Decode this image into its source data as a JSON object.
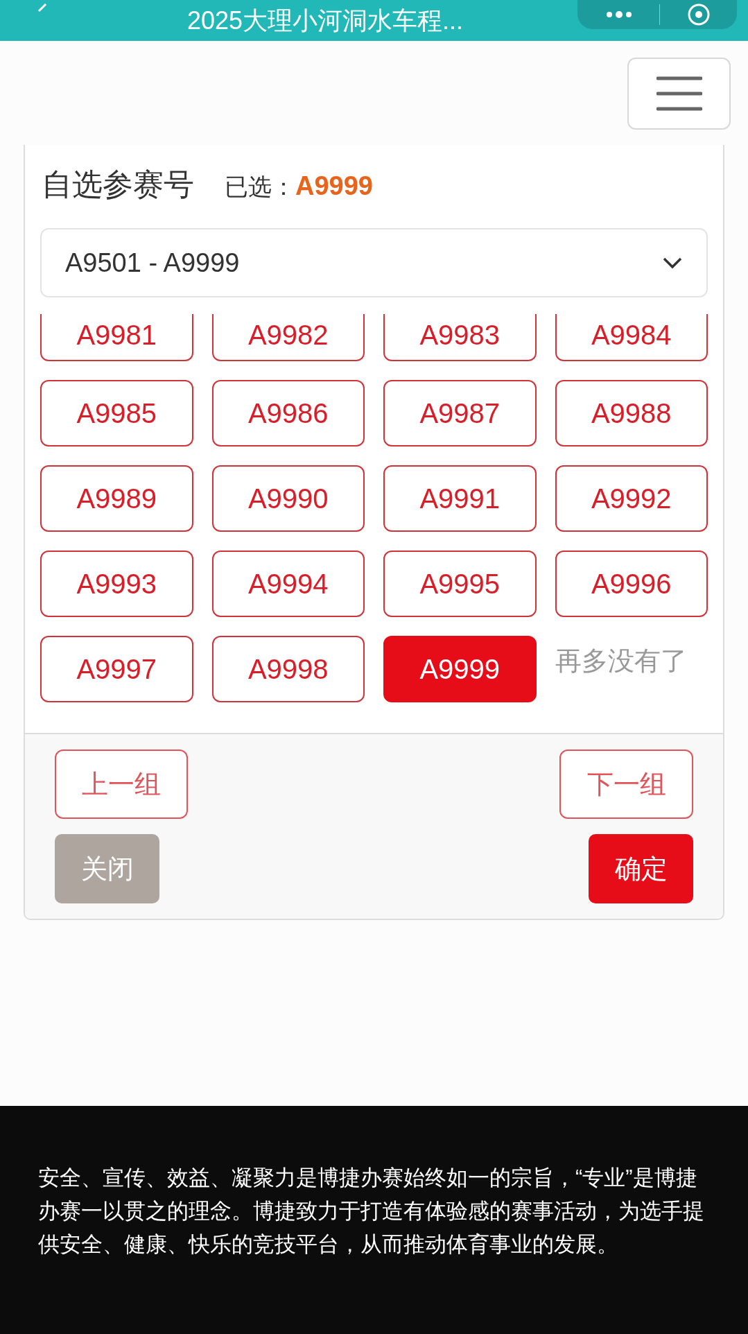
{
  "top_bar": {
    "title": "2025大理小河洞水车程..."
  },
  "picker": {
    "title": "自选参赛号",
    "selected_label": "已选：",
    "selected_value": "A9999",
    "range_select": {
      "value": "A9501 - A9999"
    },
    "numbers": [
      {
        "label": "A9981",
        "selected": false
      },
      {
        "label": "A9982",
        "selected": false
      },
      {
        "label": "A9983",
        "selected": false
      },
      {
        "label": "A9984",
        "selected": false
      },
      {
        "label": "A9985",
        "selected": false
      },
      {
        "label": "A9986",
        "selected": false
      },
      {
        "label": "A9987",
        "selected": false
      },
      {
        "label": "A9988",
        "selected": false
      },
      {
        "label": "A9989",
        "selected": false
      },
      {
        "label": "A9990",
        "selected": false
      },
      {
        "label": "A9991",
        "selected": false
      },
      {
        "label": "A9992",
        "selected": false
      },
      {
        "label": "A9993",
        "selected": false
      },
      {
        "label": "A9994",
        "selected": false
      },
      {
        "label": "A9995",
        "selected": false
      },
      {
        "label": "A9996",
        "selected": false
      },
      {
        "label": "A9997",
        "selected": false
      },
      {
        "label": "A9998",
        "selected": false
      },
      {
        "label": "A9999",
        "selected": true
      }
    ],
    "end_note": "再多没有了",
    "prev_button": "上一组",
    "next_button": "下一组",
    "close_button": "关闭",
    "confirm_button": "确定"
  },
  "footer": {
    "text": "安全、宣传、效益、凝聚力是博捷办赛始终如一的宗旨，“专业”是博捷办赛一以贯之的理念。博捷致力于打造有体验感的赛事活动，为选手提供安全、健康、快乐的竞技平台，从而推动体育事业的发展。"
  }
}
